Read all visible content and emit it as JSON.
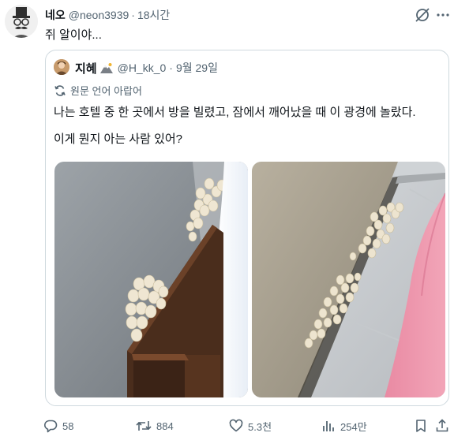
{
  "tweet": {
    "display_name": "네오",
    "handle": "@neon3939",
    "separator": "·",
    "time": "18시간",
    "text": "쥐 알이야...",
    "avatar_icon": "top-hat-mustache-avatar"
  },
  "quote": {
    "display_name": "지혜",
    "badge_icon": "mountain-emoji-icon",
    "handle": "@H_kk_0",
    "separator": "·",
    "date": "9월 29일",
    "translate_label": "원문 언어 아랍어",
    "line1": "나는 호텔 중 한 곳에서 방을 빌렸고, 잠에서 깨어났을 때 이 광경에 놀랐다.",
    "line2": "이게 뭔지 아는 사람 있어?",
    "photos": [
      "eggs-behind-bed-photo",
      "eggs-along-wall-photo"
    ]
  },
  "actions": {
    "replies": "58",
    "reposts": "884",
    "likes": "5.3천",
    "views": "254만"
  },
  "colors": {
    "text": "#0f1419",
    "secondary": "#536471",
    "border": "#cfd9de"
  }
}
